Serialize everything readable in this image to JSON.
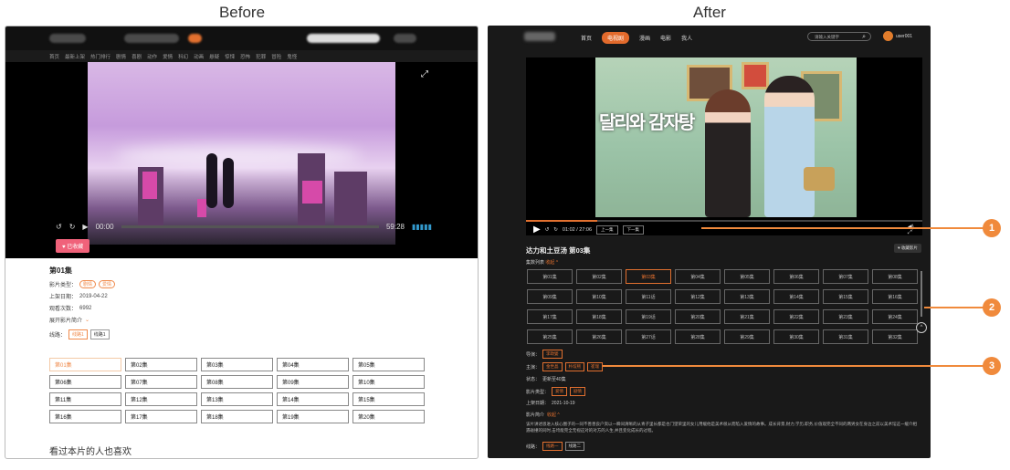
{
  "headings": {
    "before": "Before",
    "after": "After"
  },
  "before": {
    "nav_items": [
      "首页",
      "最新上架",
      "热门排行",
      "剧情",
      "喜剧",
      "动作",
      "爱情",
      "科幻",
      "动画",
      "悬疑",
      "惊悚",
      "恐怖",
      "犯罪",
      "冒险",
      "鬼怪"
    ],
    "player": {
      "current_time": "00:00",
      "duration": "59:28"
    },
    "fav_label": "已收藏",
    "episode_title": "第01集",
    "genre_label": "影片类型：",
    "genres": [
      "剧情",
      "爱情"
    ],
    "date_label": "上架日期：",
    "date": "2019-04-22",
    "views_label": "观看次数：",
    "views": "6992",
    "expand_label": "展开影片简介",
    "lines_label": "线路：",
    "lines": [
      "线路1",
      "线路1"
    ],
    "episodes": [
      "第01集",
      "第02集",
      "第03集",
      "第04集",
      "第05集",
      "第06集",
      "第07集",
      "第08集",
      "第09集",
      "第10集",
      "第11集",
      "第12集",
      "第13集",
      "第14集",
      "第15集",
      "第16集",
      "第17集",
      "第18集",
      "第19集",
      "第20集"
    ],
    "also_watched": "看过本片的人也喜欢"
  },
  "after": {
    "nav_items": [
      "首页",
      "电视剧",
      "漫画",
      "电影",
      "我人"
    ],
    "active_nav": 1,
    "search_placeholder": "请输入关键字",
    "search_icon": "search-icon",
    "username": "user001",
    "poster_title": "달리와 감자탕",
    "player": {
      "time": "01:02 / 27:06",
      "prev": "上一集",
      "next": "下一集",
      "progress": 0.18
    },
    "episode_title": "达力和土豆汤 第03集",
    "fav_label": "收藏影片",
    "list_label": "集数列表",
    "collapse": "收起 ^",
    "episodes": [
      "第01集",
      "第02集",
      "第03集",
      "第04集",
      "第05集",
      "第06集",
      "第07集",
      "第08集",
      "第09集",
      "第10集",
      "第11话",
      "第12集",
      "第13集",
      "第14集",
      "第15集",
      "第16集",
      "第17集",
      "第18集",
      "第19话",
      "第20集",
      "第21集",
      "第22集",
      "第23集",
      "第24集",
      "第25集",
      "第26集",
      "第27话",
      "第28集",
      "第29集",
      "第30集",
      "第31集",
      "第32集"
    ],
    "active_episode": 2,
    "director_label": "导演：",
    "director": "李政燮",
    "cast_label": "主演：",
    "cast": [
      "金世晶",
      "朴炫熙",
      "崔瑞"
    ],
    "status_label": "状态：",
    "status": "更新至40集",
    "type_label": "影片类型：",
    "types": [
      "爱情",
      "剧情"
    ],
    "date_label": "上架日期：",
    "date": "2021-10-19",
    "synopsis_label": "影片简介",
    "synopsis_toggle": "收起 ^",
    "synopsis": "该片讲述恩进入核心圈子的一同不善善良户资以一瞬间清晰的从青子里长都是也门望荣里的女儿用缓他是美术很从而陷入爱情的故事。成长背景,财力,学历,职务,价值观完全不同的两男女在身边之前以美术馆这一缓介相遇碰撞的同时,击垮能完全无视这对的对方的人生,并且变化成长的过程。",
    "lines_label": "线路：",
    "lines": [
      "线路一",
      "线路二"
    ]
  },
  "callouts": [
    "1",
    "2",
    "3"
  ]
}
